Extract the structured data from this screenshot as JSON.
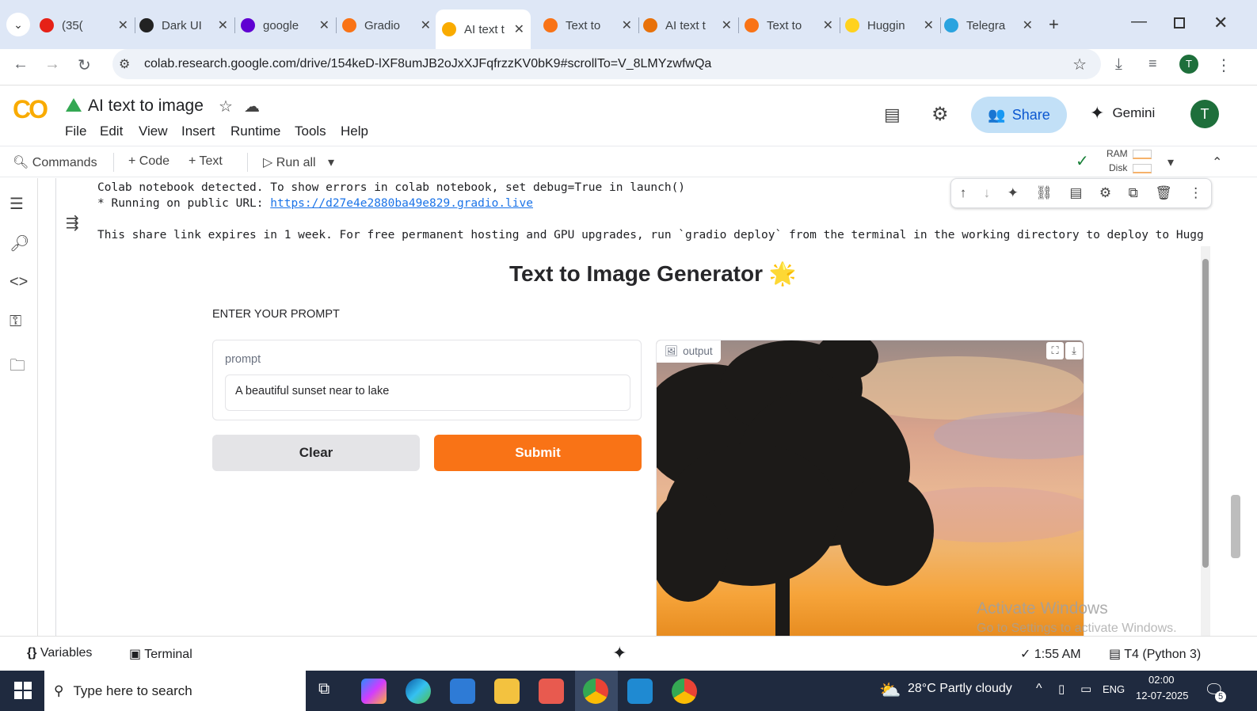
{
  "browser": {
    "tabs": [
      {
        "title": "(35(",
        "fav": "#e62117"
      },
      {
        "title": "Dark UI",
        "fav": "#222"
      },
      {
        "title": "google",
        "fav": "#6001d2"
      },
      {
        "title": "Gradio",
        "fav": "#f97316"
      },
      {
        "title": "AI text t",
        "fav": "#f9ab00",
        "active": true
      },
      {
        "title": "Text to",
        "fav": "#f97316"
      },
      {
        "title": "AI text t",
        "fav": "#e8710a"
      },
      {
        "title": "Text to",
        "fav": "#f97316"
      },
      {
        "title": "Huggin",
        "fav": "#ffd21e"
      },
      {
        "title": "Telegra",
        "fav": "#2aa3df"
      }
    ],
    "url": "colab.research.google.com/drive/154keD-lXF8umJB2oJxXJFqfrzzKV0bK9#scrollTo=V_8LMYzwfwQa",
    "profile_initial": "T"
  },
  "colab": {
    "logo": "CO",
    "notebook_title": "AI text to image",
    "menu": [
      "File",
      "Edit",
      "View",
      "Insert",
      "Runtime",
      "Tools",
      "Help"
    ],
    "share_label": "Share",
    "gemini_label": "Gemini",
    "avatar": "T",
    "commands_label": "Commands",
    "code_label": "+ Code",
    "text_label": "+ Text",
    "run_all_label": "Run all",
    "ram_label": "RAM",
    "disk_label": "Disk"
  },
  "output": {
    "line1": "Colab notebook detected. To show errors in colab notebook, set debug=True in launch()",
    "line2": "* Running on public URL: ",
    "public_url": "https://d27e4e2880ba49e829.gradio.live",
    "line3": "This share link expires in 1 week. For free permanent hosting and GPU upgrades, run `gradio deploy` from the terminal in the working directory to deploy to Hugg"
  },
  "gradio": {
    "title": "Text to Image Generator 🌟",
    "section_label": "ENTER YOUR PROMPT",
    "prompt_label": "prompt",
    "prompt_value": "A beautiful sunset near to lake",
    "clear_label": "Clear",
    "submit_label": "Submit",
    "output_label": "output"
  },
  "watermark": {
    "line1": "Activate Windows",
    "line2": "Go to Settings to activate Windows."
  },
  "statusbar": {
    "variables_label": "Variables",
    "terminal_label": "Terminal",
    "time": "1:55 AM",
    "runtime": "T4 (Python 3)"
  },
  "taskbar": {
    "search_placeholder": "Type here to search",
    "weather": "28°C  Partly cloudy",
    "lang": "ENG",
    "clock_time": "02:00",
    "clock_date": "12-07-2025",
    "notif_count": "5"
  }
}
